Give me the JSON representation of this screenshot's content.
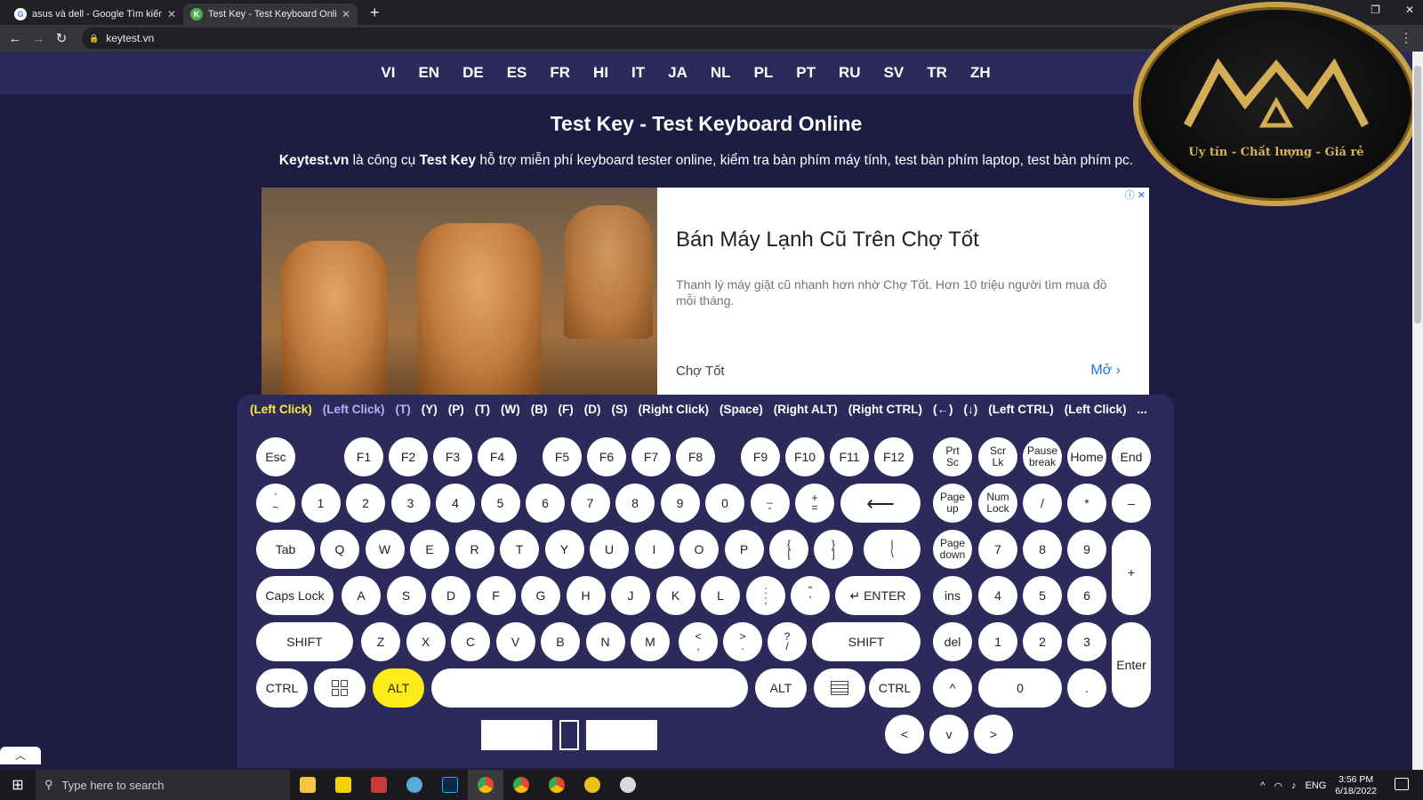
{
  "browser": {
    "tabs": [
      {
        "title": "asus và dell - Google Tìm kiếm",
        "favicon": "google-icon"
      },
      {
        "title": "Test Key - Test Keyboard Online",
        "favicon": "keytest-icon"
      }
    ],
    "url": "keytest.vn"
  },
  "languages": [
    "VI",
    "EN",
    "DE",
    "ES",
    "FR",
    "HI",
    "IT",
    "JA",
    "NL",
    "PL",
    "PT",
    "RU",
    "SV",
    "TR",
    "ZH"
  ],
  "page": {
    "title": "Test Key - Test Keyboard Online",
    "intro_brand": "Keytest.vn",
    "intro_mid": " là công cụ ",
    "intro_bold": "Test Key",
    "intro_rest": " hỗ trợ miễn phí keyboard tester online, kiểm tra bàn phím máy tính, test bàn phím laptop, test bàn phím pc."
  },
  "ad": {
    "headline": "Bán Máy Lạnh Cũ Trên Chợ Tốt",
    "text": "Thanh lý máy giặt cũ nhanh hơn nhờ Chợ Tốt. Hơn 10 triệu người tìm mua đồ mỗi tháng.",
    "source": "Chợ Tốt",
    "cta": "Mở ›",
    "close": "ⓘ ✕"
  },
  "key_log": [
    "(Left Click)",
    "(Left Click)",
    "(T)",
    "(Y)",
    "(P)",
    "(T)",
    "(W)",
    "(B)",
    "(F)",
    "(D)",
    "(S)",
    "(Right Click)",
    "(Space)",
    "(Right ALT)",
    "(Right CTRL)",
    "(←)",
    "(↓)",
    "(Left CTRL)",
    "(Left Click)",
    "..."
  ],
  "keys": {
    "fn": [
      "Esc",
      "F1",
      "F2",
      "F3",
      "F4",
      "F5",
      "F6",
      "F7",
      "F8",
      "F9",
      "F10",
      "F11",
      "F12"
    ],
    "sys": [
      "Prt\nSc",
      "Scr\nLk",
      "Pause\nbreak",
      "Home",
      "End"
    ],
    "num_row": [
      "`",
      "1",
      "2",
      "3",
      "4",
      "5",
      "6",
      "7",
      "8",
      "9",
      "0",
      "_",
      "+",
      "⟵"
    ],
    "num_row_sub": [
      "~",
      "",
      "",
      "",
      "",
      "",
      "",
      "",
      "",
      "",
      "",
      "-",
      "="
    ],
    "nav1": [
      "Page\nup",
      "Num\nLock",
      "/",
      "*",
      "–"
    ],
    "q_row": [
      "Tab",
      "Q",
      "W",
      "E",
      "R",
      "T",
      "Y",
      "U",
      "I",
      "O",
      "P"
    ],
    "q_extra": [
      [
        "{",
        "["
      ],
      [
        "}",
        "]"
      ],
      [
        "|",
        "\\"
      ]
    ],
    "nav2": [
      "Page\ndown",
      "7",
      "8",
      "9",
      "+"
    ],
    "a_row": [
      "Caps Lock",
      "A",
      "S",
      "D",
      "F",
      "G",
      "H",
      "J",
      "K",
      "L"
    ],
    "a_extra": [
      [
        ":",
        ";"
      ],
      [
        "\"",
        "'"
      ]
    ],
    "enter": "↵ ENTER",
    "nav3": [
      "ins",
      "4",
      "5",
      "6"
    ],
    "z_row": [
      "SHIFT",
      "Z",
      "X",
      "C",
      "V",
      "B",
      "N",
      "M"
    ],
    "z_extra": [
      [
        "<",
        ","
      ],
      [
        ">",
        "."
      ],
      [
        "?",
        "/"
      ]
    ],
    "rshift": "SHIFT",
    "nav4": [
      "del",
      "1",
      "2",
      "3",
      "Enter"
    ],
    "bottom": [
      "CTRL",
      "ALT",
      "ALT",
      "CTRL"
    ],
    "nav5": [
      "^",
      "0",
      "."
    ],
    "arrows": [
      "<",
      "v",
      ">"
    ]
  },
  "active_key": "ALT",
  "watermark": {
    "logo": "MM",
    "slogan": "Uy tín - Chất lượng - Giá rẻ"
  },
  "taskbar": {
    "search_placeholder": "Type here to search",
    "lang": "ENG",
    "time": "3:56 PM",
    "date": "6/18/2022"
  }
}
